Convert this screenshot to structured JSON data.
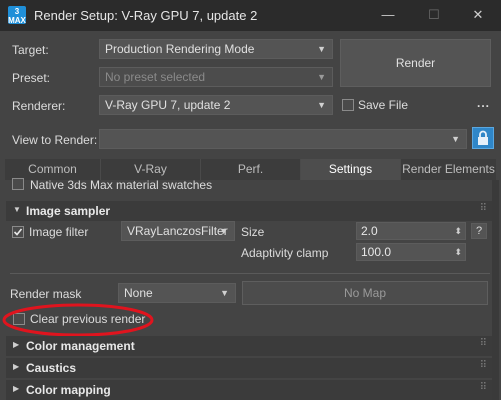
{
  "window": {
    "title": "Render Setup: V-Ray GPU 7, update 2",
    "icon_text": "3 MAX",
    "minimize_glyph": "—",
    "maximize_glyph": "☐",
    "close_glyph": "✕"
  },
  "setup": {
    "target_label": "Target:",
    "target_value": "Production Rendering Mode",
    "preset_label": "Preset:",
    "preset_value": "No preset selected",
    "renderer_label": "Renderer:",
    "renderer_value": "V-Ray GPU 7, update 2",
    "render_button": "Render",
    "save_file_label": "Save File",
    "save_file_checked": false,
    "more_button": "...",
    "view_to_render_label": "View to Render:",
    "view_to_render_value": ""
  },
  "tabs": [
    {
      "label": "Common",
      "active": false
    },
    {
      "label": "V-Ray",
      "active": false
    },
    {
      "label": "Perf.",
      "active": false
    },
    {
      "label": "Settings",
      "active": true
    },
    {
      "label": "Render Elements",
      "active": false
    }
  ],
  "settings": {
    "native_swatches_label": "Native 3ds Max material swatches",
    "image_sampler": {
      "title": "Image sampler",
      "image_filter_label": "Image filter",
      "image_filter_checked": true,
      "filter_value": "VRayLanczosFilter",
      "size_label": "Size",
      "size_value": "2.0",
      "adaptivity_label": "Adaptivity clamp",
      "adaptivity_value": "100.0",
      "help_button": "?"
    },
    "render_mask_label": "Render mask",
    "render_mask_value": "None",
    "no_map_button": "No Map",
    "clear_previous_label": "Clear previous render",
    "clear_previous_checked": false
  },
  "rollouts": [
    {
      "title": "Color management"
    },
    {
      "title": "Caustics"
    },
    {
      "title": "Color mapping"
    }
  ],
  "colors": {
    "annotation": "#e0141e",
    "accent_lock": "#2f86c8"
  }
}
